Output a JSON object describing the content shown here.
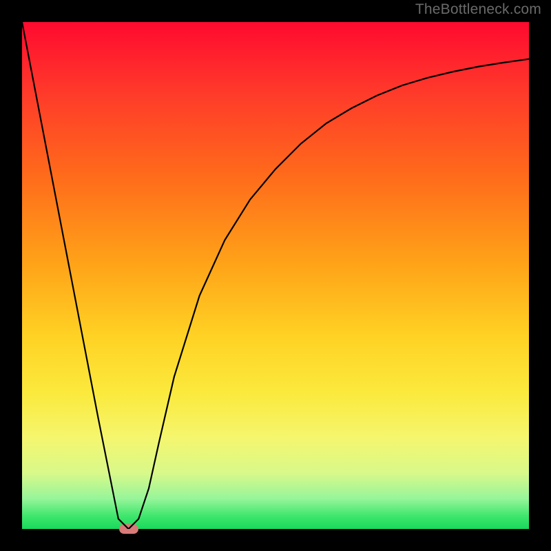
{
  "watermark": "TheBottleneck.com",
  "chart_data": {
    "type": "line",
    "title": "",
    "xlabel": "",
    "ylabel": "",
    "xlim": [
      0,
      100
    ],
    "ylim": [
      0,
      100
    ],
    "grid": false,
    "legend": false,
    "background_gradient_stops": [
      {
        "pct": 0,
        "color": "#ff0a2f"
      },
      {
        "pct": 14,
        "color": "#ff3a2a"
      },
      {
        "pct": 30,
        "color": "#ff6a1b"
      },
      {
        "pct": 48,
        "color": "#ffa418"
      },
      {
        "pct": 62,
        "color": "#ffd224"
      },
      {
        "pct": 73,
        "color": "#fbe93c"
      },
      {
        "pct": 82,
        "color": "#f5f66e"
      },
      {
        "pct": 89,
        "color": "#d8f98a"
      },
      {
        "pct": 94,
        "color": "#97f59a"
      },
      {
        "pct": 97.5,
        "color": "#3ee66c"
      },
      {
        "pct": 100,
        "color": "#18d95c"
      }
    ],
    "series": [
      {
        "name": "bottleneck-curve",
        "color": "#000000",
        "x": [
          0,
          5,
          10,
          15,
          19,
          21,
          23,
          25,
          27,
          30,
          35,
          40,
          45,
          50,
          55,
          60,
          65,
          70,
          75,
          80,
          85,
          90,
          95,
          100
        ],
        "y": [
          100,
          74,
          48,
          22,
          2,
          0,
          2,
          8,
          17,
          30,
          46,
          57,
          65,
          71,
          76,
          80,
          83,
          85.5,
          87.5,
          89,
          90.2,
          91.2,
          92,
          92.7
        ]
      }
    ],
    "marker": {
      "x": 21,
      "y": 0,
      "color": "#d87a78"
    }
  }
}
